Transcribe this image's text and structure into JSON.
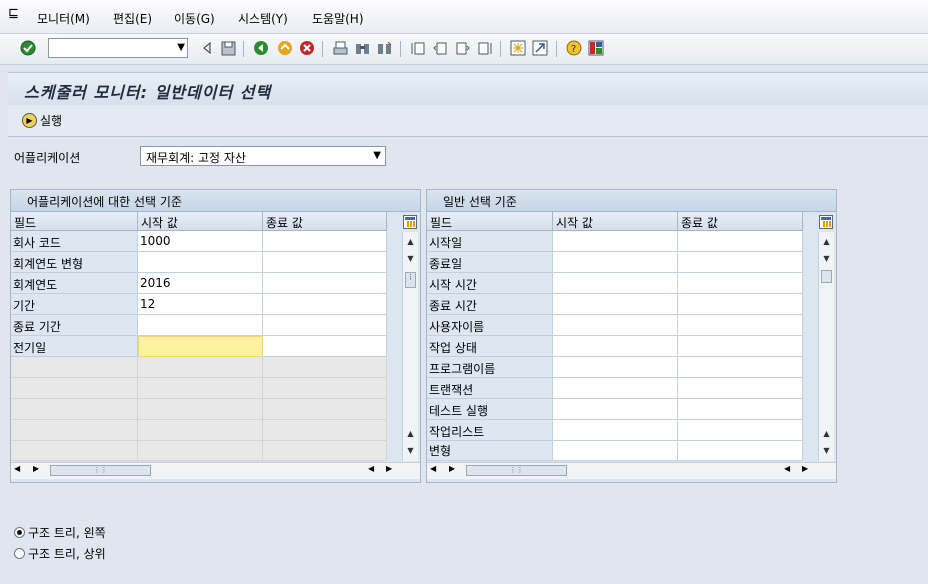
{
  "menubar": {
    "items": [
      {
        "label": "모니터(M)"
      },
      {
        "label": "편집(E)"
      },
      {
        "label": "이동(G)"
      },
      {
        "label": "시스템(Y)"
      },
      {
        "label": "도움말(H)"
      }
    ]
  },
  "toolbar": {
    "command_value": ""
  },
  "page": {
    "title": "스케줄러 모니터: 일반데이터 선택",
    "execute_label": "실행"
  },
  "application": {
    "label": "어플리케이션",
    "selected": "재무회계: 고정 자산"
  },
  "app_criteria": {
    "title": "어플리케이션에 대한 선택 기준",
    "headers": [
      "필드",
      "시작 값",
      "종료 값"
    ],
    "rows": [
      {
        "field": "회사 코드",
        "from": "1000",
        "to": ""
      },
      {
        "field": "회계연도 변형",
        "from": "",
        "to": ""
      },
      {
        "field": "회계연도",
        "from": "2016",
        "to": ""
      },
      {
        "field": "기간",
        "from": "12",
        "to": ""
      },
      {
        "field": "종료 기간",
        "from": "",
        "to": ""
      },
      {
        "field": "전기일",
        "from": "",
        "to": ""
      }
    ]
  },
  "general_criteria": {
    "title": "일반 선택 기준",
    "headers": [
      "필드",
      "시작 값",
      "종료 값"
    ],
    "rows": [
      {
        "field": "시작일",
        "from": "",
        "to": ""
      },
      {
        "field": "종료일",
        "from": "",
        "to": ""
      },
      {
        "field": "시작 시간",
        "from": "",
        "to": ""
      },
      {
        "field": "종료 시간",
        "from": "",
        "to": ""
      },
      {
        "field": "사용자이름",
        "from": "",
        "to": ""
      },
      {
        "field": "작업 상태",
        "from": "",
        "to": ""
      },
      {
        "field": "프로그램이름",
        "from": "",
        "to": ""
      },
      {
        "field": "트랜잭션",
        "from": "",
        "to": ""
      },
      {
        "field": "테스트 실행",
        "from": "",
        "to": ""
      },
      {
        "field": "작업리스트",
        "from": "",
        "to": ""
      },
      {
        "field": "변형",
        "from": "",
        "to": ""
      }
    ]
  },
  "display_options": [
    {
      "label": "구조 트리, 왼쪽",
      "selected": true
    },
    {
      "label": "구조 트리, 상위",
      "selected": false
    }
  ]
}
